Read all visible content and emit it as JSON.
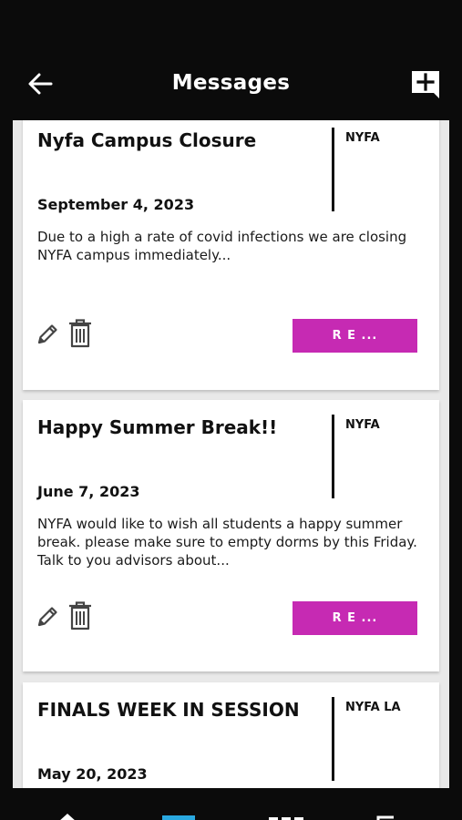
{
  "header": {
    "title": "Messages"
  },
  "messages": [
    {
      "title": "Nyfa Campus Closure",
      "sender": "NYFA",
      "date": "September 4, 2023",
      "body": "Due to a high a rate of covid infections we are closing NYFA campus immediately...",
      "read_label": "R   E   ..."
    },
    {
      "title": "Happy Summer Break!!",
      "sender": "NYFA",
      "date": "June 7, 2023",
      "body": "NYFA would like to wish all students a happy summer break. please make sure to empty dorms by this Friday. Talk to you advisors about...",
      "read_label": "R   E   ..."
    },
    {
      "title": "FINALS WEEK IN SESSION",
      "sender": "NYFA LA",
      "date": "May 20, 2023"
    }
  ],
  "colors": {
    "accent": "#c62ab3",
    "header_bg": "#0b0b0b",
    "list_bg": "#e9e9e9",
    "nav_active": "#29a8e0"
  },
  "icons": {
    "back": "arrow-left-icon",
    "compose": "add-message-icon",
    "edit": "pencil-icon",
    "delete": "trash-icon"
  }
}
